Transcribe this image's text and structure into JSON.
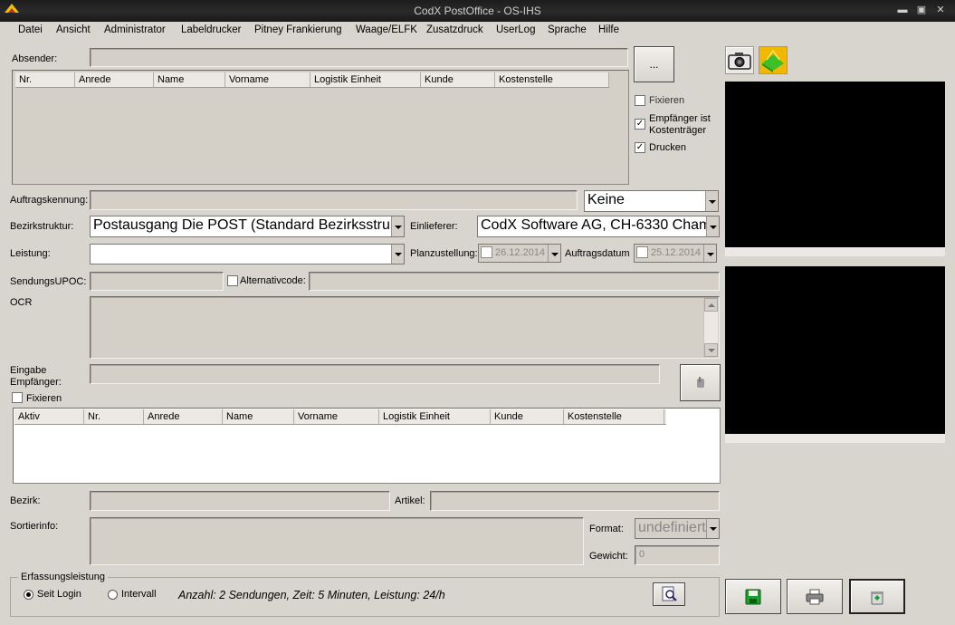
{
  "window": {
    "title": "CodX PostOffice - OS-IHS"
  },
  "menu": [
    "Datei",
    "Ansicht",
    "Administrator",
    "Labeldrucker",
    "Pitney Frankierung",
    "Waage/ELFK",
    "Zusatzdruck",
    "UserLog",
    "Sprache",
    "Hilfe"
  ],
  "absender": {
    "label": "Absender:",
    "value": "",
    "browse_label": "...",
    "columns": [
      "Nr.",
      "Anrede",
      "Name",
      "Vorname",
      "Logistik Einheit",
      "Kunde",
      "Kostenstelle"
    ]
  },
  "options": {
    "fixieren": {
      "label": "Fixieren",
      "checked": false
    },
    "kostentraeger": {
      "label": "Empfänger ist Kostenträger",
      "checked": true
    },
    "drucken": {
      "label": "Drucken",
      "checked": true
    }
  },
  "auftrag": {
    "label": "Auftragskennung:",
    "value": "",
    "select": "Keine"
  },
  "bezirk_struktur": {
    "label": "Bezirkstruktur:",
    "value": "Postausgang Die POST (Standard Bezirksstruktur)"
  },
  "einlieferer": {
    "label": "Einlieferer:",
    "value": "CodX Software AG, CH-6330 Cham"
  },
  "leistung": {
    "label": "Leistung:",
    "value": ""
  },
  "planzustellung": {
    "label": "Planzustellung:",
    "value": "26.12.2014"
  },
  "auftragsdatum": {
    "label": "Auftragsdatum",
    "value": "25.12.2014"
  },
  "sendungsupoc": {
    "label": "SendungsUPOC:",
    "value": ""
  },
  "alternativcode": {
    "label": "Alternativcode:",
    "value": "",
    "checked": false
  },
  "ocr": {
    "label": "OCR",
    "value": ""
  },
  "eingabe": {
    "label": "Eingabe Empfänger:",
    "value": "",
    "fixieren_label": "Fixieren",
    "fixieren_checked": false
  },
  "empfaenger_columns": [
    "Aktiv",
    "Nr.",
    "Anrede",
    "Name",
    "Vorname",
    "Logistik Einheit",
    "Kunde",
    "Kostenstelle"
  ],
  "bezirk": {
    "label": "Bezirk:",
    "value": ""
  },
  "artikel": {
    "label": "Artikel:",
    "value": ""
  },
  "sortierinfo": {
    "label": "Sortierinfo:",
    "value": ""
  },
  "format": {
    "label": "Format:",
    "value": "undefiniert"
  },
  "gewicht": {
    "label": "Gewicht:",
    "value": "0"
  },
  "erfassung": {
    "title": "Erfassungsleistung",
    "option1": "Seit Login",
    "option2": "Intervall",
    "selected": "Seit Login",
    "summary": "Anzahl: 2 Sendungen, Zeit: 5 Minuten, Leistung: 24/h"
  },
  "icons": {
    "camera": "camera-icon",
    "scanner": "scanner-icon",
    "save": "save-icon",
    "print": "printer-icon",
    "clear": "recycle-icon",
    "search": "magnifier-icon",
    "pointer": "hand-pointer-icon"
  },
  "colors": {
    "titlebar": "#1c1c1c",
    "window": "#d8d4ce",
    "video": "#000000",
    "accent_green": "#1e9e2c"
  }
}
